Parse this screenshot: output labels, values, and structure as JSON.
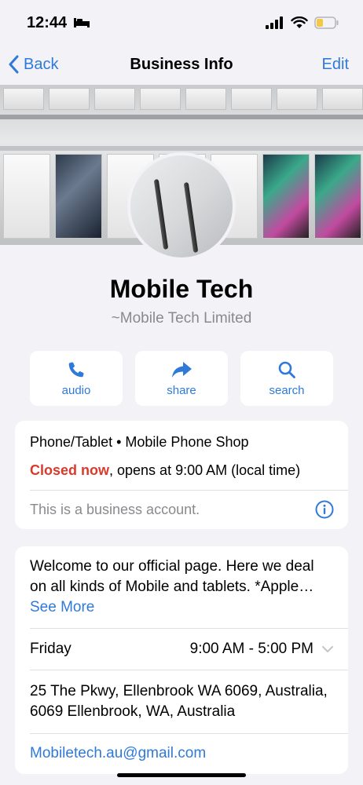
{
  "status_bar": {
    "time": "12:44"
  },
  "nav": {
    "back_label": "Back",
    "title": "Business Info",
    "edit_label": "Edit"
  },
  "profile": {
    "name": "Mobile Tech",
    "subname": "~Mobile Tech Limited"
  },
  "actions": [
    {
      "label": "audio",
      "icon": "phone-icon"
    },
    {
      "label": "share",
      "icon": "share-arrow-icon"
    },
    {
      "label": "search",
      "icon": "search-icon"
    }
  ],
  "info_card": {
    "category": "Phone/Tablet • Mobile Phone Shop",
    "status": "Closed now",
    "hours_note": ", opens at 9:00 AM (local time)",
    "business_note": "This is a business account."
  },
  "details_card": {
    "description": "Welcome to our official page. Here we deal on all kinds of Mobile and tablets. *Apple…",
    "see_more": "See More",
    "day": "Friday",
    "hours": "9:00 AM - 5:00 PM",
    "address": "25 The Pkwy, Ellenbrook WA 6069, Australia, 6069 Ellenbrook, WA, Australia",
    "email": "Mobiletech.au@gmail.com"
  },
  "colors": {
    "accent": "#2f7ad8",
    "closed": "#d93a2b",
    "background": "#f2f2f7"
  }
}
